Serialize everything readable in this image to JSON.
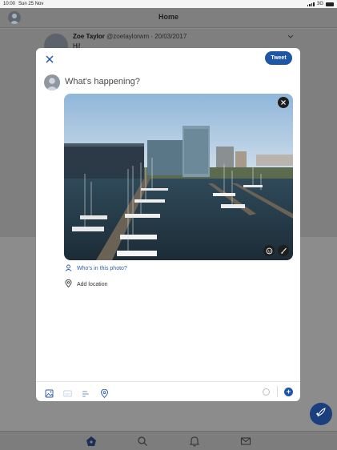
{
  "status_bar": {
    "time": "10:00",
    "date": "Sun 25 Nov",
    "network": "3G"
  },
  "header": {
    "title": "Home"
  },
  "background_tweet": {
    "name": "Zoe Taylor",
    "handle_date": "@zoetaylorwm · 20/03/2017",
    "text": "Hi!"
  },
  "compose": {
    "tweet_label": "Tweet",
    "placeholder": "What's happening?",
    "tag_people_label": "Who's in this photo?",
    "add_location_label": "Add location"
  },
  "icons": {
    "close": "close-icon",
    "photo_remove": "close-icon",
    "photo_sticker": "sticker-icon",
    "photo_edit": "brush-icon",
    "tag": "person-icon",
    "location": "location-pin-icon",
    "toolbar": [
      "image-icon",
      "gif-icon",
      "poll-icon",
      "location-pin-icon"
    ],
    "tabs": [
      "home-icon",
      "search-icon",
      "notifications-icon",
      "messages-icon"
    ],
    "fab": "compose-feather-icon"
  },
  "colors": {
    "accent": "#1f57a7",
    "fab": "#1a3f7c"
  }
}
